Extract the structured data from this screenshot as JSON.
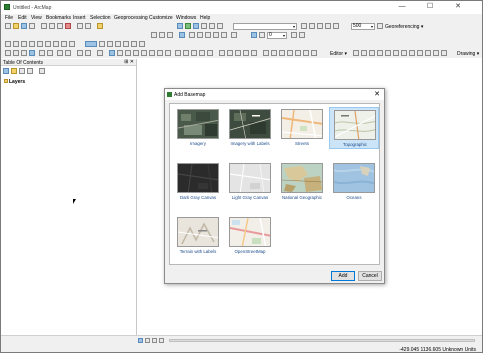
{
  "window": {
    "title": "Untitled - ArcMap",
    "minimize": "—",
    "maximize": "☐",
    "close": "✕"
  },
  "menu": [
    "File",
    "Edit",
    "View",
    "Bookmarks",
    "Insert",
    "Selection",
    "Geoprocessing",
    "Customize",
    "Windows",
    "Help"
  ],
  "toolbar": {
    "scale_value": "500",
    "georeferencing_label": "Georeferencing ▾",
    "layer_value": "0",
    "editor_label": "Editor ▾",
    "drawing_label": "Drawing ▾"
  },
  "toc": {
    "title": "Table Of Contents",
    "pin": "⊞ ✕",
    "root_label": "Layers"
  },
  "dialog": {
    "title": "Add Basemap",
    "close": "✕",
    "basemaps": [
      {
        "label": "Imagery",
        "selected": false
      },
      {
        "label": "Imagery with Labels",
        "selected": false
      },
      {
        "label": "Streets",
        "selected": false
      },
      {
        "label": "Topographic",
        "selected": true
      },
      {
        "label": "Dark Gray Canvas",
        "selected": false
      },
      {
        "label": "Light Gray Canvas",
        "selected": false
      },
      {
        "label": "National Geographic",
        "selected": false
      },
      {
        "label": "Oceans",
        "selected": false
      },
      {
        "label": "Terrain with Labels",
        "selected": false
      },
      {
        "label": "OpenStreetMap",
        "selected": false
      }
    ],
    "add_label": "Add",
    "cancel_label": "Cancel"
  },
  "status": {
    "coords": "-429.045  1136.605 Unknown Units"
  }
}
